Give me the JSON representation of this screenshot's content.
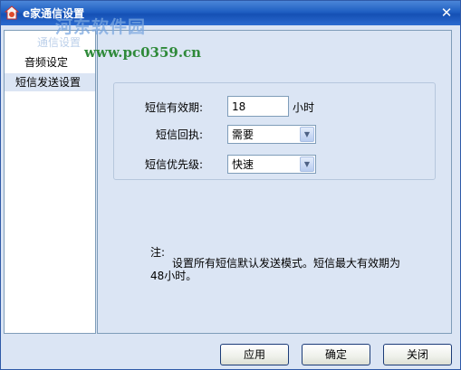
{
  "window": {
    "title": "e家通信设置",
    "close_glyph": "✕"
  },
  "watermark": {
    "name": "河东软件园",
    "url": "www.pc0359.cn"
  },
  "sidebar": {
    "items": [
      {
        "label": "通信设置"
      },
      {
        "label": "音频设定"
      },
      {
        "label": "短信发送设置",
        "selected": true
      }
    ]
  },
  "form": {
    "validity": {
      "label": "短信有效期:",
      "value": "18",
      "unit": "小时"
    },
    "receipt": {
      "label": "短信回执:",
      "selected": "需要"
    },
    "priority": {
      "label": "短信优先级:",
      "selected": "快速"
    }
  },
  "note": {
    "title": "注:",
    "body": "设置所有短信默认发送模式。短信最大有效期为48小时。"
  },
  "buttons": {
    "apply": "应用",
    "ok": "确定",
    "close": "关闭"
  },
  "colors": {
    "titlebar": "#1f5fc2",
    "panel": "#dbe5f4",
    "border": "#7f9db9"
  }
}
